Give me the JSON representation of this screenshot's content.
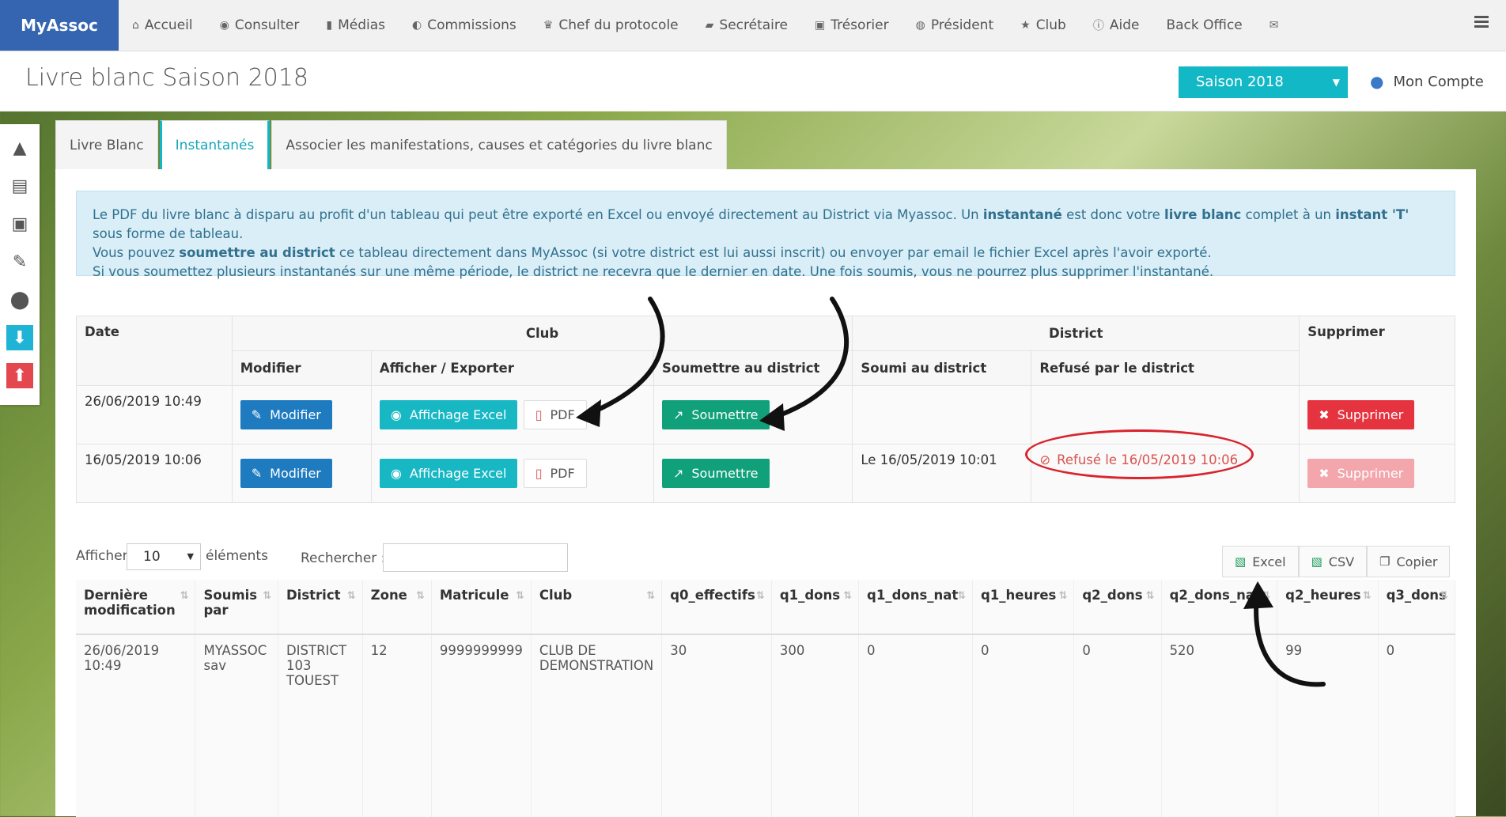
{
  "nav": {
    "brand": "MyAssoc",
    "items": [
      {
        "label": "Accueil",
        "icon": "home-icon",
        "glyph": "⌂"
      },
      {
        "label": "Consulter",
        "icon": "eye-icon",
        "glyph": "◉"
      },
      {
        "label": "Médias",
        "icon": "file-icon",
        "glyph": "▮"
      },
      {
        "label": "Commissions",
        "icon": "user-circle-icon",
        "glyph": "◐"
      },
      {
        "label": "Chef du protocole",
        "icon": "trophy-icon",
        "glyph": "♛"
      },
      {
        "label": "Secrétaire",
        "icon": "book-icon",
        "glyph": "▰"
      },
      {
        "label": "Trésorier",
        "icon": "money-icon",
        "glyph": "▣"
      },
      {
        "label": "Président",
        "icon": "globe-icon",
        "glyph": "◍"
      },
      {
        "label": "Club",
        "icon": "star-icon",
        "glyph": "★"
      },
      {
        "label": "Aide",
        "icon": "info-icon",
        "glyph": "ⓘ"
      },
      {
        "label": "Back Office",
        "icon": "",
        "glyph": ""
      },
      {
        "label": "",
        "icon": "envelope-icon",
        "glyph": "✉"
      }
    ]
  },
  "header": {
    "title": "Livre blanc Saison 2018",
    "season": "Saison 2018",
    "account": "Mon Compte"
  },
  "tabs": [
    {
      "label": "Livre Blanc"
    },
    {
      "label": "Instantanés"
    },
    {
      "label": "Associer les manifestations, causes et catégories du livre blanc"
    }
  ],
  "alert": {
    "l1a": "Le PDF du livre blanc à disparu au profit d'un tableau qui peut être exporté en Excel ou envoyé directement au District via Myassoc. Un ",
    "l1b": "instantané",
    "l1c": " est donc votre ",
    "l1d": "livre blanc",
    "l1e": " complet à un ",
    "l1f": "instant 'T'",
    "l1g": " sous forme de tableau.",
    "l2a": "Vous pouvez ",
    "l2b": "soumettre au district",
    "l2c": " ce tableau directement dans MyAssoc (si votre district est lui aussi inscrit) ou envoyer par email le fichier Excel après l'avoir exporté.",
    "l3": "Si vous soumettez plusieurs instantanés sur une même période, le district ne recevra que le dernier en date. Une fois soumis, vous ne pourrez plus supprimer l'instantané."
  },
  "snapshots": {
    "headers": {
      "date": "Date",
      "club": "Club",
      "district": "District",
      "delete": "Supprimer",
      "modify": "Modifier",
      "display": "Afficher / Exporter",
      "submit": "Soumettre au district",
      "submitted": "Soumi au district",
      "refused": "Refusé par le district"
    },
    "labels": {
      "modify": "Modifier",
      "excel": "Affichage Excel",
      "pdf": "PDF",
      "submit": "Soumettre",
      "delete": "Supprimer"
    },
    "rows": [
      {
        "date": "26/06/2019 10:49",
        "submitted": "",
        "refused": ""
      },
      {
        "date": "16/05/2019 10:06",
        "submitted": "Le 16/05/2019 10:01",
        "refused": "Refusé le 16/05/2019 10:06"
      }
    ]
  },
  "datatable": {
    "show_label": "Afficher",
    "page_size": "10",
    "elements_label": "éléments",
    "search_label": "Rechercher :",
    "export": {
      "excel": "Excel",
      "csv": "CSV",
      "copy": "Copier"
    },
    "columns": [
      "Dernière modification",
      "Soumis par",
      "District",
      "Zone",
      "Matricule",
      "Club",
      "q0_effectifs",
      "q1_dons",
      "q1_dons_nat",
      "q1_heures",
      "q2_dons",
      "q2_dons_nat",
      "q2_heures",
      "q3_dons"
    ],
    "rows": [
      [
        "26/06/2019 10:49",
        "MYASSOC sav",
        "DISTRICT 103 TOUEST",
        "12",
        "9999999999",
        "CLUB DE DEMONSTRATION",
        "30",
        "300",
        "0",
        "0",
        "0",
        "520",
        "99",
        "0"
      ]
    ]
  }
}
